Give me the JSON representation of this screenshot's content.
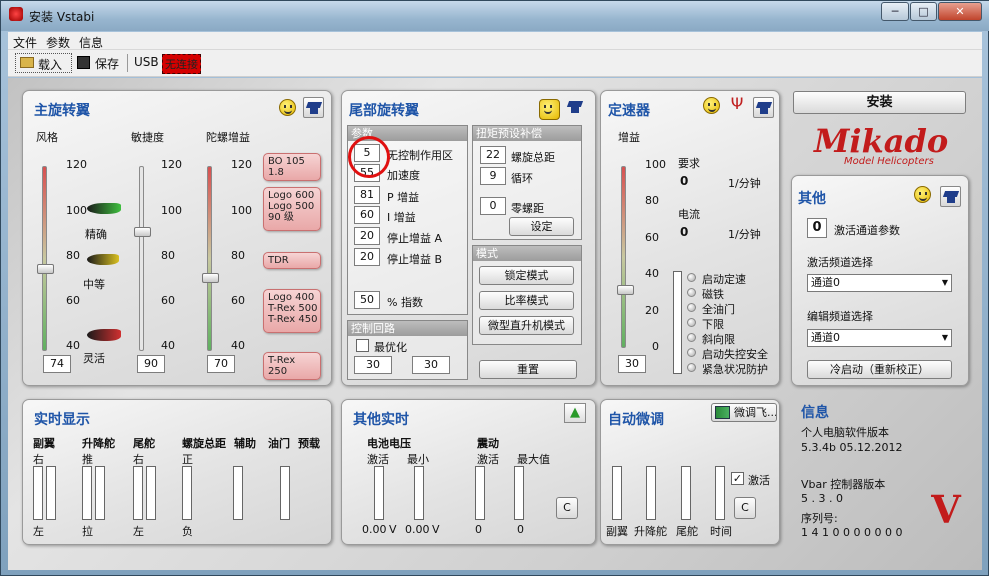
{
  "window": {
    "title": "安装 Vstabi",
    "min": "─",
    "max": "□",
    "close": "✕"
  },
  "menu": [
    "文件",
    "参数",
    "信息"
  ],
  "toolbar": {
    "load": "载入",
    "save": "保存",
    "usb": "USB",
    "conn": "无连接"
  },
  "main": {
    "title": "主旋转翼",
    "col1": "风格",
    "col2": "敏捷度",
    "col3": "陀螺增益",
    "ticks": [
      "120",
      "100",
      "80",
      "60",
      "40"
    ],
    "style_labels": [
      "精确",
      "中等",
      "灵活"
    ],
    "values": {
      "style": "74",
      "agility": "90",
      "gyro": "70"
    },
    "callouts": [
      "BO 105 1.8",
      "Logo 600\nLogo 500\n90 级",
      "TDR",
      "Logo 400\nT-Rex 500\nT-Rex 450",
      "T-Rex 250"
    ]
  },
  "tail": {
    "title": "尾部旋转翼",
    "params_header": "参数",
    "params": [
      {
        "v": "5",
        "l": "无控制作用区"
      },
      {
        "v": "55",
        "l": "加速度"
      },
      {
        "v": "81",
        "l": "P 增益"
      },
      {
        "v": "60",
        "l": "I 增益"
      },
      {
        "v": "20",
        "l": "停止增益 A"
      },
      {
        "v": "20",
        "l": "停止增益 B"
      }
    ],
    "index_val": "50",
    "index_lbl": "% 指数",
    "torque_header": "扭矩预设补偿",
    "torque": [
      {
        "v": "22",
        "l": "螺旋总距"
      },
      {
        "v": "9",
        "l": "循环"
      },
      {
        "v": "0",
        "l": "零螺距"
      }
    ],
    "set_btn": "设定",
    "mode_header": "模式",
    "modes": [
      "锁定模式",
      "比率模式",
      "微型直升机模式"
    ],
    "control_header": "控制回路",
    "optimize": "最优化",
    "ctrl_vals": [
      "30",
      "30"
    ],
    "reset_btn": "重置"
  },
  "governor": {
    "title": "定速器",
    "gain": "增益",
    "ticks": [
      "100",
      "80",
      "60",
      "40",
      "20",
      "0"
    ],
    "value": "30",
    "demand": "要求",
    "demand_val": "0",
    "current": "电流",
    "current_val": "0",
    "unit": "1/分钟",
    "status": [
      "启动定速",
      "磁铁",
      "全油门",
      "下限",
      "斜向限",
      "启动失控安全",
      "紧急状况防护"
    ]
  },
  "install": {
    "btn": "安装",
    "logo_main": "Mikado",
    "logo_sub": "Model Helicopters"
  },
  "other": {
    "title": "其他",
    "chan_val": "0",
    "chan_lbl": "激活通道参数",
    "freq1_lbl": "激活频道选择",
    "freq1": "通道0",
    "freq2_lbl": "编辑频道选择",
    "freq2": "通道0",
    "cold_btn": "冷启动（重新校正）"
  },
  "realtime": {
    "title": "实时显示",
    "cols": [
      {
        "h": "副翼",
        "t": "右",
        "b": "左"
      },
      {
        "h": "升降舵",
        "t": "推",
        "b": "拉"
      },
      {
        "h": "尾舵",
        "t": "右",
        "b": "左"
      },
      {
        "h": "螺旋总距",
        "t": "正",
        "b": "负"
      },
      {
        "h": "辅助",
        "t": "",
        "b": ""
      },
      {
        "h": "油门",
        "t": "",
        "b": ""
      },
      {
        "h": "预载",
        "t": "",
        "b": ""
      }
    ]
  },
  "other_rt": {
    "title": "其他实时",
    "battery": "电池电压",
    "vib": "震动",
    "activate": "激活",
    "min": "最小",
    "max": "最大值",
    "vals": [
      "0.00",
      "V",
      "0.00",
      "V",
      "0",
      "0"
    ],
    "c_btn": "C"
  },
  "fine": {
    "title": "自动微调",
    "btn": "微调飞...",
    "activate": "激活",
    "cols": [
      "副翼",
      "升降舵",
      "尾舵",
      "时间"
    ],
    "c_btn": "C"
  },
  "info": {
    "title": "信息",
    "pc_lbl": "个人电脑软件版本",
    "pc_ver": "5.3.4b  05.12.2012",
    "vbar_lbl": "Vbar 控制器版本",
    "vbar_ver": "5 . 3 . 0",
    "serial_lbl": "序列号:",
    "serial": "1 4 1 0 0 0 0 0 0 0"
  },
  "colors": {
    "accent": "#1f55a8",
    "conn": "#d40000"
  }
}
